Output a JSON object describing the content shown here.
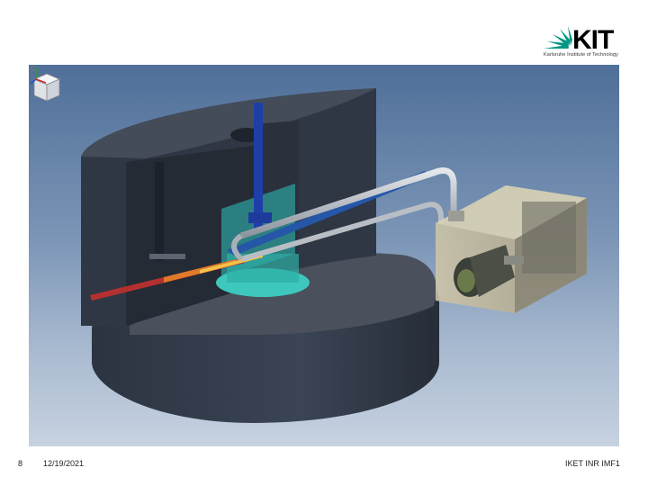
{
  "logo": {
    "wordmark": "KIT",
    "tagline": "Karlsruhe Institute of Technology",
    "accent_color": "#009682"
  },
  "viewport": {
    "description_icon": "cad-3d-model",
    "viewcube_icon": "viewcube-icon",
    "triad_icon": "axis-triad-icon"
  },
  "footer": {
    "page_number": "8",
    "date": "12/19/2021",
    "institute": "IKET INR IMF1"
  }
}
